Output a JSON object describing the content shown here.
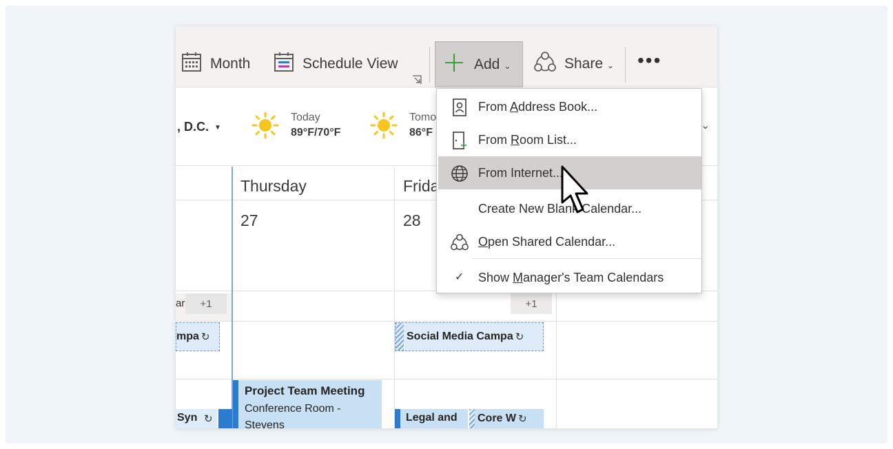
{
  "ribbon": {
    "month_label": "Month",
    "schedule_label": "Schedule View",
    "add_label": "Add",
    "share_label": "Share",
    "more_label": "•••"
  },
  "weather": {
    "location": ", D.C.",
    "today_label": "Today",
    "today_temp": "89°F/70°F",
    "tomorrow_label": "Tomo",
    "tomorrow_temp": "86°F"
  },
  "calendar": {
    "days": [
      {
        "name": "Thursday",
        "number": "27"
      },
      {
        "name": "Frida",
        "number": "28"
      }
    ],
    "overflow_left": "+1",
    "overflow_right": "+1",
    "partial_allday_text": "ar",
    "events": {
      "left_dashed": "mpa",
      "social_media": "Social Media Campa",
      "ptm_title": "Project Team Meeting",
      "ptm_location_1": "Conference Room -",
      "ptm_location_2": "Stevens",
      "left_sync": "Syn",
      "legal": "Legal and",
      "core": "Core W"
    }
  },
  "add_menu": {
    "items": [
      {
        "pre": "From ",
        "acc": "A",
        "post": "ddress Book...",
        "icon": "address-book-icon"
      },
      {
        "pre": "From ",
        "acc": "R",
        "post": "oom List...",
        "icon": "room-list-icon"
      },
      {
        "pre": "From ",
        "acc": "",
        "post": "Internet...",
        "icon": "globe-icon"
      },
      {
        "pre": "Create New Bla",
        "acc": "",
        "post": "nk Calendar...",
        "icon": ""
      },
      {
        "pre": "",
        "acc": "O",
        "post": "pen Shared Calendar...",
        "icon": "shared-calendar-icon"
      },
      {
        "pre": "Show ",
        "acc": "M",
        "post": "anager's Team Calendars",
        "icon": "check-icon"
      }
    ],
    "check_mark": "✓"
  },
  "colors": {
    "accent_green": "#3a9d3a",
    "sun": "#f7c51e",
    "event_blue": "#2b7bd1"
  }
}
